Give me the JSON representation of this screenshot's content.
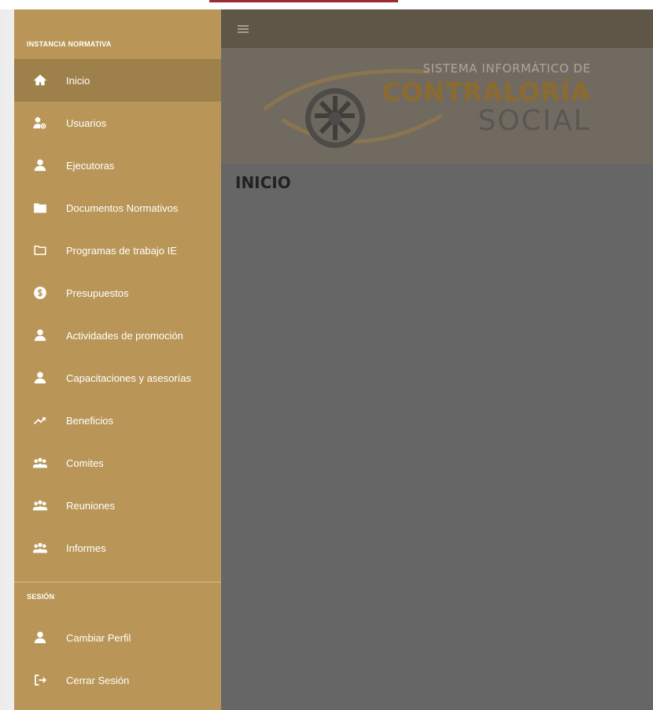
{
  "sidebar": {
    "section_main": "INSTANCIA NORMATIVA",
    "items": [
      {
        "label": "Inicio",
        "icon": "home-icon"
      },
      {
        "label": "Usuarios",
        "icon": "user-gear-icon"
      },
      {
        "label": "Ejecutoras",
        "icon": "user-icon"
      },
      {
        "label": "Documentos Normativos",
        "icon": "folder-icon"
      },
      {
        "label": "Programas de trabajo IE",
        "icon": "folder-outline-icon"
      },
      {
        "label": "Presupuestos",
        "icon": "dollar-icon"
      },
      {
        "label": "Actividades de promoción",
        "icon": "user-icon"
      },
      {
        "label": "Capacitaciones y asesorías",
        "icon": "user-icon"
      },
      {
        "label": "Beneficios",
        "icon": "trend-icon"
      },
      {
        "label": "Comites",
        "icon": "group-icon"
      },
      {
        "label": "Reuniones",
        "icon": "group-icon"
      },
      {
        "label": "Informes",
        "icon": "group-icon"
      }
    ],
    "section_session": "SESIÓN",
    "session_items": [
      {
        "label": "Cambiar Perfil",
        "icon": "user-icon"
      },
      {
        "label": "Cerrar Sesión",
        "icon": "logout-icon"
      }
    ]
  },
  "header": {
    "line1": "SISTEMA INFORMÁTICO DE",
    "line2": "CONTRALORÍA",
    "line3": "SOCIAL"
  },
  "page": {
    "title": "INICIO"
  },
  "colors": {
    "sidebar": "#b99657",
    "sidebar_active": "#9e804b",
    "overlay": "#666666",
    "topbar": "#5f5648",
    "header_band": "#706a61",
    "brand_gold": "#8d6b2f"
  }
}
